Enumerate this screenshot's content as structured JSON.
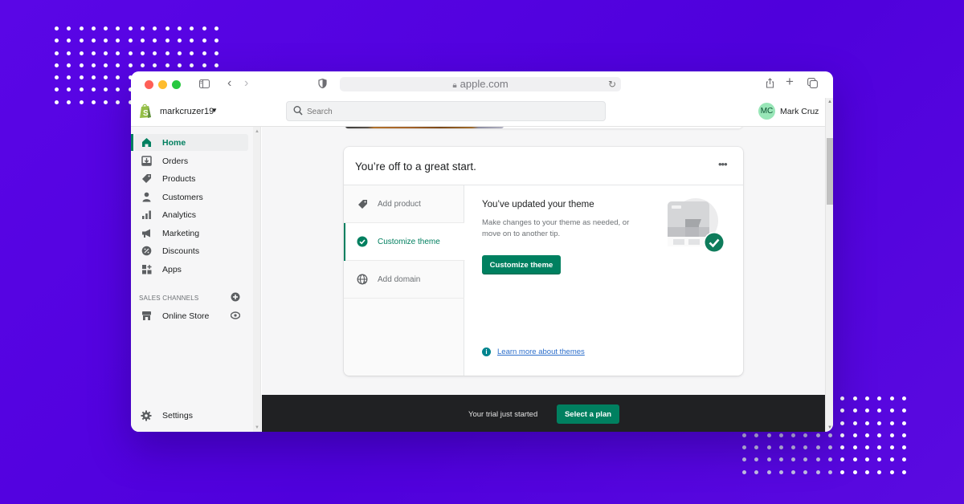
{
  "browser": {
    "url": "apple.com",
    "icons": [
      "sidebar-toggle-icon",
      "back-icon",
      "forward-icon",
      "shield-icon",
      "lock-icon",
      "reload-icon",
      "share-icon",
      "new-tab-icon",
      "tabs-overview-icon"
    ]
  },
  "topbar": {
    "store_name": "markcruzer19",
    "search_placeholder": "Search",
    "user_initials": "MC",
    "user_name": "Mark Cruz"
  },
  "sidebar": {
    "items": [
      {
        "label": "Home",
        "icon": "home-icon",
        "active": true
      },
      {
        "label": "Orders",
        "icon": "orders-icon"
      },
      {
        "label": "Products",
        "icon": "tag-icon"
      },
      {
        "label": "Customers",
        "icon": "person-icon"
      },
      {
        "label": "Analytics",
        "icon": "bar-chart-icon"
      },
      {
        "label": "Marketing",
        "icon": "megaphone-icon"
      },
      {
        "label": "Discounts",
        "icon": "discount-icon"
      },
      {
        "label": "Apps",
        "icon": "apps-icon"
      }
    ],
    "sales_channels_label": "SALES CHANNELS",
    "channels": [
      {
        "label": "Online Store",
        "icon": "store-icon"
      }
    ],
    "settings_label": "Settings"
  },
  "card": {
    "title": "You’re off to a great start.",
    "more_label": "•••",
    "tabs": [
      {
        "label": "Add product",
        "icon": "tag-icon"
      },
      {
        "label": "Customize theme",
        "icon": "check-circle-icon",
        "active": true
      },
      {
        "label": "Add domain",
        "icon": "globe-icon"
      }
    ],
    "panel": {
      "title": "You’ve updated your theme",
      "description": "Make changes to your theme as needed, or move on to another tip.",
      "button_label": "Customize theme",
      "learn_more": "Learn more about themes"
    }
  },
  "trial": {
    "text": "Your trial just started",
    "button_label": "Select a plan"
  },
  "colors": {
    "brand_green": "#008060",
    "background_purple": "#5500e0",
    "trial_bar": "#202123",
    "link_blue": "#2c6ecb"
  }
}
